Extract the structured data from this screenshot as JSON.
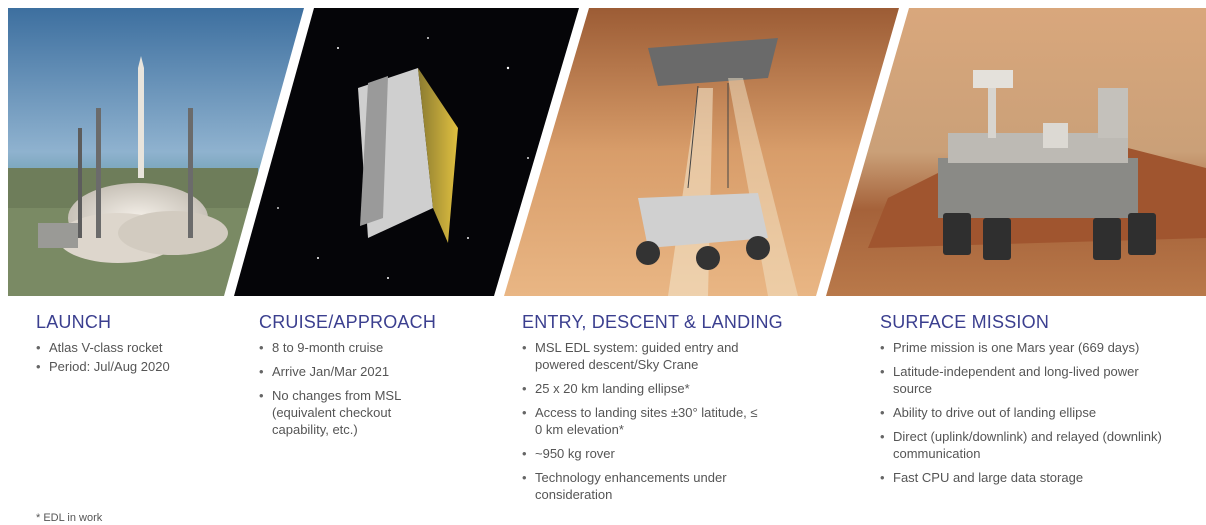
{
  "panels": [
    {
      "id": "launch",
      "title": "LAUNCH",
      "bullets": [
        "Atlas V-class rocket",
        "Period: Jul/Aug 2020"
      ]
    },
    {
      "id": "cruise",
      "title": "CRUISE/APPROACH",
      "bullets": [
        "8 to 9-month cruise",
        "Arrive Jan/Mar 2021",
        "No changes from MSL (equivalent checkout capability, etc.)"
      ]
    },
    {
      "id": "edl",
      "title": "ENTRY, DESCENT & LANDING",
      "bullets": [
        "MSL EDL system: guided entry and powered descent/Sky Crane",
        "25 x 20 km landing ellipse*",
        "Access to landing sites ±30° latitude, ≤ 0 km elevation*",
        "~950 kg rover",
        "Technology enhancements under consideration"
      ]
    },
    {
      "id": "surface",
      "title": "SURFACE MISSION",
      "bullets": [
        "Prime mission is one Mars year (669 days)",
        "Latitude-independent and long-lived power source",
        "Ability to drive out of landing ellipse",
        "Direct (uplink/downlink) and relayed (downlink) communication",
        "Fast CPU and large data storage"
      ]
    }
  ],
  "footnote": "* EDL in work",
  "colors": {
    "heading": "#3b3f8f",
    "body_text": "#555555",
    "sky_blue": "#4a7aa8",
    "space_black": "#050508",
    "mars_orange": "#c98a5a"
  }
}
